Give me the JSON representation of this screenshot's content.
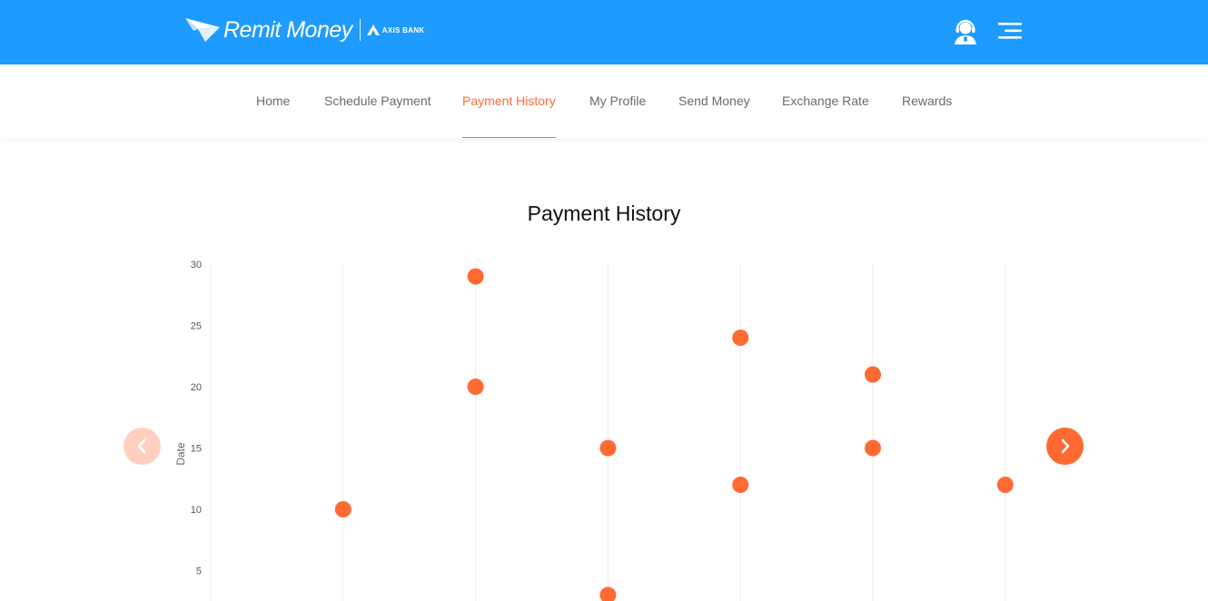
{
  "header": {
    "brand": "Remit Money",
    "bank": "AXIS BANK",
    "bg_color": "#1e9bff"
  },
  "nav": {
    "items": [
      {
        "label": "Home",
        "active": false
      },
      {
        "label": "Schedule Payment",
        "active": false
      },
      {
        "label": "Payment History",
        "active": true
      },
      {
        "label": "My Profile",
        "active": false
      },
      {
        "label": "Send Money",
        "active": false
      },
      {
        "label": "Exchange Rate",
        "active": false
      },
      {
        "label": "Rewards",
        "active": false
      }
    ],
    "active_color": "#ff6a33"
  },
  "page": {
    "title": "Payment History"
  },
  "icons": {
    "support": "headset-user-icon",
    "menu": "hamburger-menu-icon",
    "prev": "chevron-left-icon",
    "next": "chevron-right-icon"
  },
  "chart_data": {
    "type": "scatter",
    "ylabel": "Date",
    "xlabel": "",
    "ylim": [
      3,
      30
    ],
    "yticks": [
      5,
      10,
      15,
      20,
      25,
      30
    ],
    "grid": "vertical",
    "point_color": "#ff6a33",
    "categories": [
      "",
      "",
      "",
      "",
      "",
      "",
      ""
    ],
    "points": [
      {
        "x": 1,
        "y": 10
      },
      {
        "x": 2,
        "y": 29
      },
      {
        "x": 2,
        "y": 20
      },
      {
        "x": 3,
        "y": 15
      },
      {
        "x": 3,
        "y": 3
      },
      {
        "x": 4,
        "y": 24
      },
      {
        "x": 4,
        "y": 12
      },
      {
        "x": 5,
        "y": 21
      },
      {
        "x": 5,
        "y": 15
      },
      {
        "x": 6,
        "y": 12
      }
    ]
  }
}
